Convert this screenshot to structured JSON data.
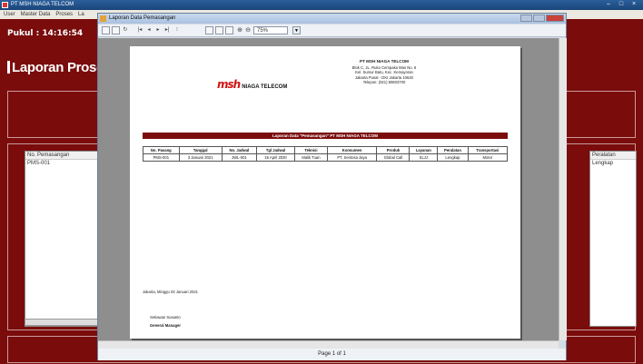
{
  "app": {
    "title": "PT MSH NIAGA TELCOM",
    "controls": [
      "–",
      "□",
      "×"
    ]
  },
  "menu": [
    "User",
    "Master Data",
    "Proses",
    "La"
  ],
  "main": {
    "clock_label": "Pukul :",
    "clock_value": "14:16:54",
    "page_title": "Laporan Prose",
    "grid_left": {
      "header": "No. Pemasangan",
      "rows": [
        "PMS-001"
      ]
    },
    "grid_right": {
      "header": "Peralatan",
      "rows": [
        "Lengkap"
      ]
    }
  },
  "dialog": {
    "title": "Laporan Data Pemasangan",
    "zoom": "75%",
    "status": "Page 1 of 1",
    "nav_buttons": [
      "|◂",
      "◂",
      "▸",
      "▸|",
      "⁝"
    ]
  },
  "report": {
    "logo_text": "NIAGA TELECOM",
    "company_name": "PT MSH NIAGA TELCOM",
    "address": [
      "Blok C, JL. Ruko Cempaka Mas No. 6",
      "Kel. Sumur Batu, Kec. Kemayoran",
      "Jakarta Pusat - DKI Jakarta 10640",
      "Telepon: (021) 80603700"
    ],
    "banner": "Laporan Data \"Pemasangan\" PT MSH NIAGA TELCOM",
    "columns": [
      "No. Pasang",
      "Tanggal",
      "No. Jadwal",
      "Tgl Jadwal",
      "Teknisi",
      "Konsumen",
      "Produk",
      "Layanan",
      "Peralatan",
      "Transportasi"
    ],
    "rows": [
      [
        "PMS-001",
        "3 Januari 2021",
        "JWL-001",
        "16 April 2020",
        "Malik Tuan",
        "PT. Sentosa Jaya",
        "Global Call",
        "SLJJ",
        "Lengkap",
        "Motor"
      ]
    ],
    "sign_place_date": "Jakarta, Minggu 03 Januari 2021",
    "sign_name": "Setiawan Susanto",
    "sign_title": "General Manager"
  },
  "colors": {
    "background": "#6b0b0b",
    "banner": "#7a0c0c",
    "logo": "#d01313"
  }
}
